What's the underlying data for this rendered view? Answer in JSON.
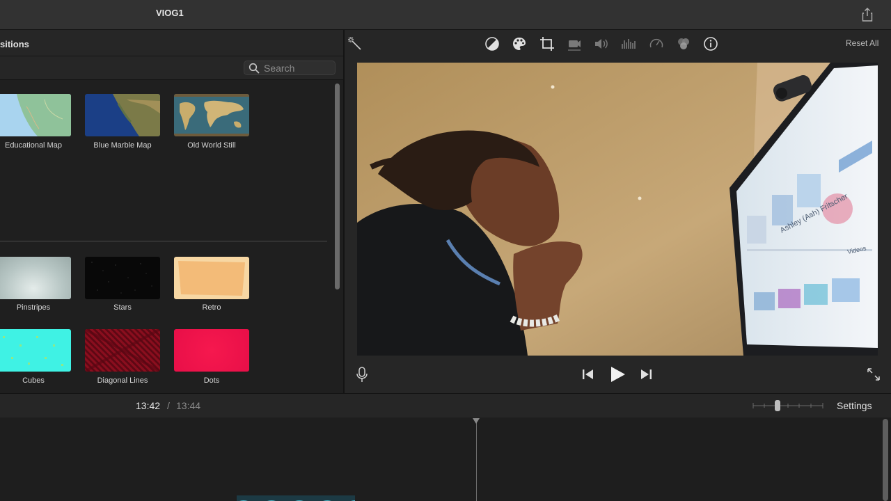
{
  "window": {
    "project_title": "VIOG1"
  },
  "browser": {
    "tab_label": "sitions",
    "search": {
      "placeholder": "Search",
      "value": ""
    },
    "maps": [
      {
        "label": "Educational Map"
      },
      {
        "label": "Blue Marble Map"
      },
      {
        "label": "Old World Still"
      }
    ],
    "backgrounds_row1": [
      {
        "label": "Pinstripes"
      },
      {
        "label": "Stars"
      },
      {
        "label": "Retro"
      }
    ],
    "backgrounds_row2": [
      {
        "label": "Cubes"
      },
      {
        "label": "Diagonal Lines"
      },
      {
        "label": "Dots"
      }
    ]
  },
  "viewer": {
    "reset_label": "Reset All",
    "tools": [
      "magic-wand-icon",
      "color-balance-icon",
      "color-palette-icon",
      "crop-icon",
      "stabilization-icon",
      "volume-icon",
      "noise-reduction-icon",
      "speed-icon",
      "clip-filter-icon",
      "info-icon"
    ],
    "screen_text": {
      "name": "Ashley (Ash) Fritscher",
      "tab": "Videos"
    }
  },
  "timeline": {
    "current_time": "13:42",
    "separator": "/",
    "total_time": "13:44",
    "settings_label": "Settings",
    "zoom_level": 0.35
  },
  "colors": {
    "accent": "#3a8ee6",
    "background": "#1e1e1e"
  }
}
